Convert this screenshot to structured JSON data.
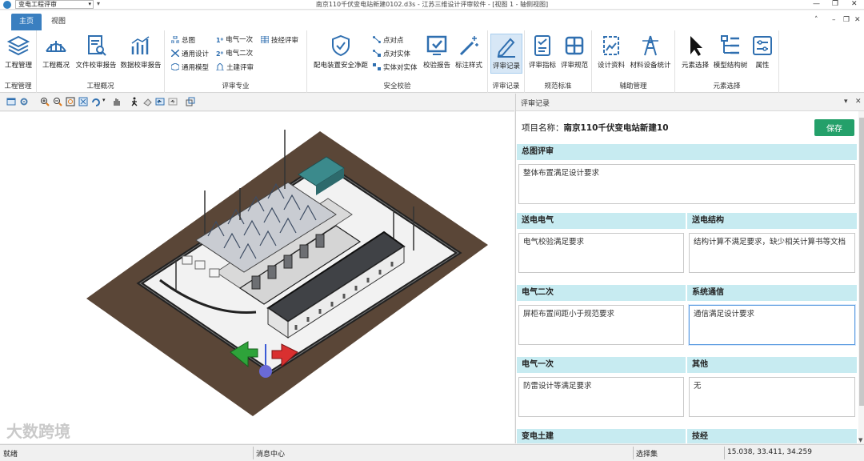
{
  "titlebar": {
    "combo": "变电工程评审",
    "quick_access": "▾",
    "title": "南京110千伏变电站新建0102.d3s - 江苏三维设计评审软件 - [视图 1 - 轴侧视图]",
    "win_min": "—",
    "win_max": "❐",
    "win_close": "✕"
  },
  "tabs": [
    {
      "label": "主页"
    },
    {
      "label": "视图"
    }
  ],
  "ribbon_ctrl": {
    "collapse": "˄",
    "min": "–",
    "restore": "❐",
    "close": "✕"
  },
  "ribbon": {
    "groups": [
      "工程管理",
      "工程概况",
      "评审专业",
      "安全校验",
      "评审记录",
      "规范标准",
      "辅助管理",
      "元素选择"
    ],
    "buttons": {
      "project_mgmt": "工程管理",
      "project_overview": "工程概况",
      "doc_report": "文件校审报告",
      "data_report": "数据校审报告",
      "safety_clear": "配电装置安全净距",
      "verify_report": "校验报告",
      "label_style": "标注样式",
      "review_record": "评审记录",
      "review_index": "评审指标",
      "review_spec": "评审规范",
      "design_data": "设计资料",
      "material_stats": "材料设备统计",
      "elem_select": "元素选择",
      "model_tree": "模型结构树",
      "attributes": "属性"
    },
    "small": {
      "general_plan": "总图",
      "elec1": "电气一次",
      "tech_review": "技经评审",
      "general_design": "通用设计",
      "elec2": "电气二次",
      "general_model": "通用模型",
      "civil": "土建评审",
      "p2p": "点对点",
      "p2e": "点对实体",
      "e2e": "实体对实体"
    }
  },
  "panel": {
    "title": "评审记录",
    "pin": "▾",
    "close": "✕",
    "project_label": "项目名称：",
    "project_name": "南京110千伏变电站新建10",
    "save": "保存",
    "sections": [
      {
        "title": "总图评审",
        "text": "整体布置满足设计要求"
      },
      {
        "title": "送电电气",
        "text": "电气校验满足要求"
      },
      {
        "title": "送电结构",
        "text": "结构计算不满足要求，缺少相关计算书等文档"
      },
      {
        "title": "电气二次",
        "text": "屏柜布置间距小于规范要求"
      },
      {
        "title": "系统通信",
        "text": "通信满足设计要求"
      },
      {
        "title": "电气一次",
        "text": "防雷设计等满足要求"
      },
      {
        "title": "其他",
        "text": "无"
      },
      {
        "title": "变电土建",
        "text": ""
      },
      {
        "title": "技经",
        "text": ""
      }
    ]
  },
  "watermark": "大数跨境",
  "status": {
    "ready": "就绪",
    "messages": "消息中心",
    "selection": "选择集",
    "coords": "15.038, 33.411, 34.259"
  },
  "colors": {
    "accent": "#3a7fc0",
    "save": "#24a06a",
    "section": "#c7ebf1",
    "ground": "#5a4637"
  }
}
